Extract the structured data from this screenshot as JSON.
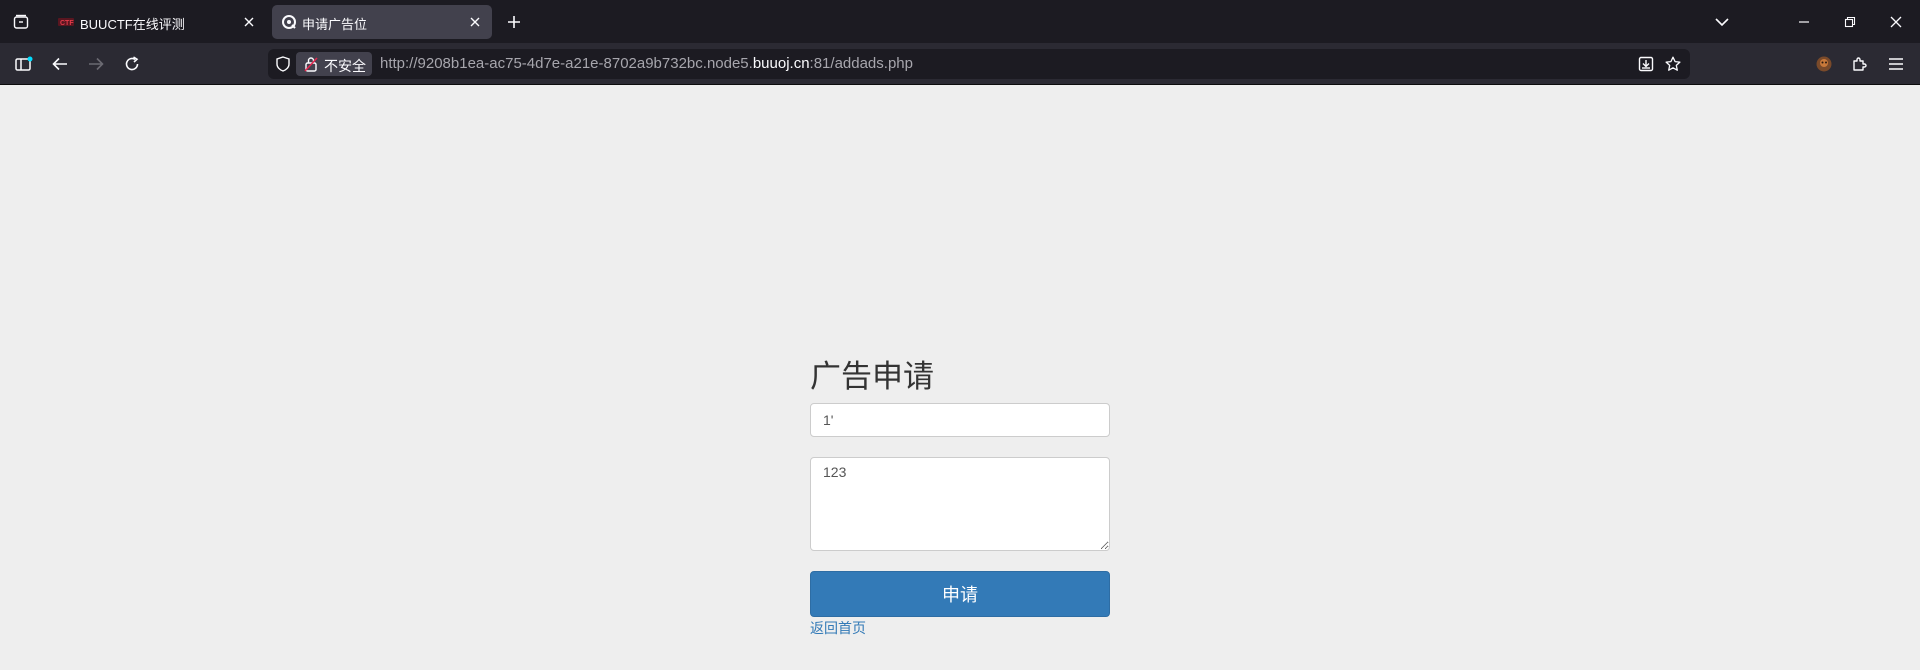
{
  "browser": {
    "tabs": [
      {
        "title": "BUUCTF在线评测",
        "active": false
      },
      {
        "title": "申请广告位",
        "active": true
      }
    ],
    "security_label": "不安全",
    "url": {
      "prefix": "http://9208b1ea-ac75-4d7e-a21e-8702a9b732bc.node5.",
      "host": "buuoj.cn",
      "suffix": ":81/addads.php"
    },
    "colors": {
      "tabbar_bg": "#1c1b22",
      "toolbar_bg": "#2b2a33",
      "active_tab_bg": "#42414d"
    }
  },
  "page": {
    "heading": "广告申请",
    "title_input_value": "1'",
    "content_textarea_value": "123",
    "submit_label": "申请",
    "back_link_label": "返回首页",
    "colors": {
      "background": "#eeeeee",
      "primary": "#337ab7"
    }
  }
}
